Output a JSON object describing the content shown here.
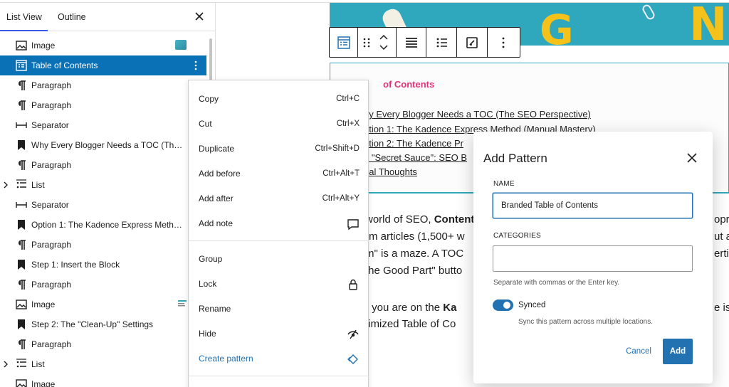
{
  "sidebar": {
    "tabs": [
      {
        "label": "List View"
      },
      {
        "label": "Outline"
      }
    ],
    "items": [
      {
        "label": "Image",
        "icon": "image-icon"
      },
      {
        "label": "Table of Contents",
        "icon": "table-of-contents-icon"
      },
      {
        "label": "Paragraph",
        "icon": "paragraph-icon"
      },
      {
        "label": "Paragraph",
        "icon": "paragraph-icon"
      },
      {
        "label": "Separator",
        "icon": "separator-icon"
      },
      {
        "label": "Why Every Blogger Needs a TOC (The SE...",
        "icon": "bookmark-icon"
      },
      {
        "label": "Paragraph",
        "icon": "paragraph-icon"
      },
      {
        "label": "List",
        "icon": "list-icon"
      },
      {
        "label": "Separator",
        "icon": "separator-icon"
      },
      {
        "label": "Option 1: The Kadence Express Method (...",
        "icon": "bookmark-icon"
      },
      {
        "label": "Paragraph",
        "icon": "paragraph-icon"
      },
      {
        "label": "Step 1: Insert the Block",
        "icon": "bookmark-icon"
      },
      {
        "label": "Paragraph",
        "icon": "paragraph-icon"
      },
      {
        "label": "Image",
        "icon": "image-icon"
      },
      {
        "label": "Step 2: The \"Clean-Up\" Settings",
        "icon": "bookmark-icon"
      },
      {
        "label": "Paragraph",
        "icon": "paragraph-icon"
      },
      {
        "label": "List",
        "icon": "list-icon"
      },
      {
        "label": "Image",
        "icon": "image-icon"
      }
    ]
  },
  "context_menu": {
    "items": [
      {
        "label": "Copy",
        "shortcut": "Ctrl+C"
      },
      {
        "label": "Cut",
        "shortcut": "Ctrl+X"
      },
      {
        "label": "Duplicate",
        "shortcut": "Ctrl+Shift+D"
      },
      {
        "label": "Add before",
        "shortcut": "Ctrl+Alt+T"
      },
      {
        "label": "Add after",
        "shortcut": "Ctrl+Alt+Y"
      },
      {
        "label": "Add note",
        "icon": "comment-icon"
      },
      {
        "label": "Group"
      },
      {
        "label": "Lock",
        "icon": "lock-icon"
      },
      {
        "label": "Rename"
      },
      {
        "label": "Hide",
        "icon": "eye-slash-icon"
      },
      {
        "label": "Create pattern",
        "icon": "symbol-icon"
      }
    ]
  },
  "editor": {
    "toc_title": "of Contents",
    "toc_links": [
      "hy Every Blogger Needs a TOC (The SEO Perspective)",
      "ption 1: The Kadence Express Method (Manual Mastery)",
      "ption 2: The Kadence Pr",
      "e \"Secret Sauce\": SEO B",
      "nal Thoughts"
    ],
    "body": [
      {
        "pre": "world of SEO, ",
        "bold": "Content",
        "post": ""
      },
      {
        "pre": "rm articles (1,500+ w",
        "bold": "",
        "post": ""
      },
      {
        "pre": "m\" is a maze. A TOC",
        "bold": "",
        "post": ""
      },
      {
        "pre": " the Good Part\" butto",
        "bold": "",
        "post": ""
      },
      {
        "pre": "r you are on the ",
        "bold": "Ka",
        "post": ""
      },
      {
        "pre": "timized Table of Co",
        "bold": "",
        "post": ""
      }
    ],
    "right_fragments": [
      "opr",
      "ut a",
      "erti",
      "e is"
    ]
  },
  "modal": {
    "title": "Add Pattern",
    "name_label": "NAME",
    "name_value": "Branded Table of Contents",
    "categories_label": "CATEGORIES",
    "categories_help": "Separate with commas or the Enter key.",
    "synced_label": "Synced",
    "synced_on": true,
    "synced_help": "Sync this pattern across multiple locations.",
    "cancel_label": "Cancel",
    "add_label": "Add"
  },
  "colors": {
    "selected_row": "#0b71b6",
    "accent": "#2271b1",
    "toc_title": "#e0327b",
    "hero_bg": "#2fa7bd"
  }
}
